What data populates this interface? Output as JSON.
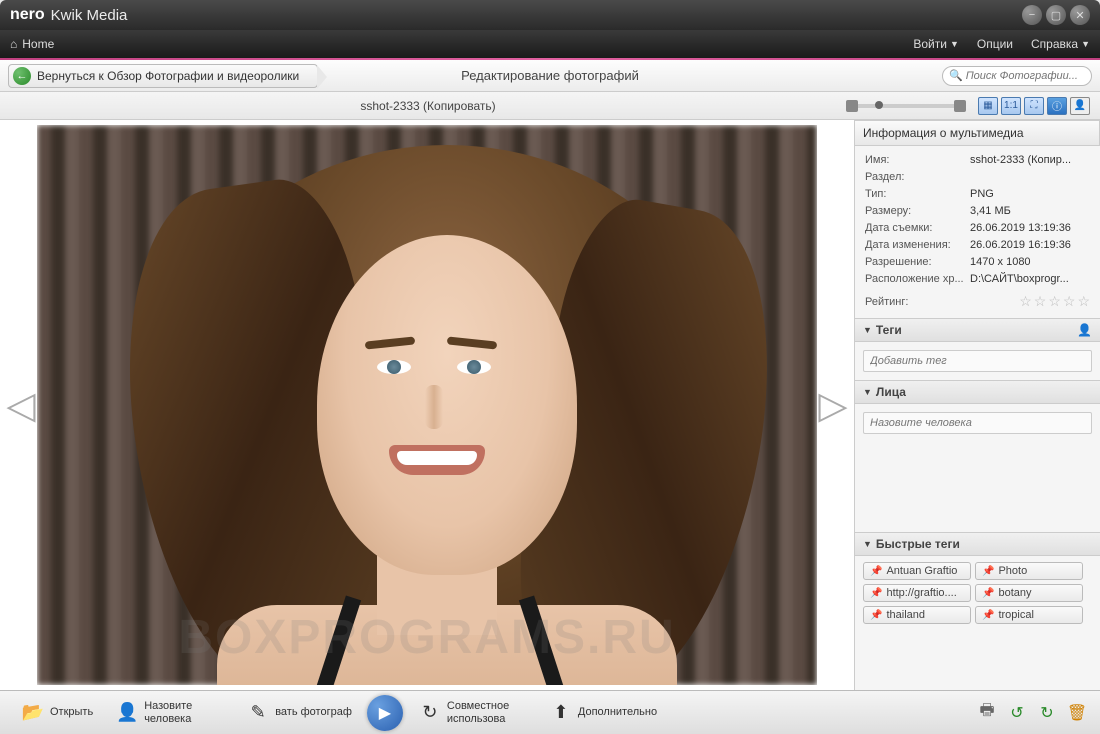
{
  "titlebar": {
    "brand": "nero",
    "product": "Kwik Media"
  },
  "menubar": {
    "home": "Home",
    "right": [
      {
        "label": "Войти",
        "chevron": true
      },
      {
        "label": "Опции",
        "chevron": false
      },
      {
        "label": "Справка",
        "chevron": true
      }
    ]
  },
  "breadcrumb": {
    "back": "Вернуться к Обзор Фотографии и видеоролики",
    "title": "Редактирование фотографий",
    "search_placeholder": "Поиск Фотографии..."
  },
  "file_row": {
    "name": "sshot-2333 (Копировать)"
  },
  "view_icons": [
    "fit-window-icon",
    "actual-size-icon",
    "fullscreen-icon",
    "info-icon",
    "user-icon"
  ],
  "watermark": "BOXPROGRAMS.RU",
  "info_panel": {
    "title": "Информация о мультимедиа",
    "rows": [
      {
        "k": "Имя:",
        "v": "sshot-2333 (Копир..."
      },
      {
        "k": "Раздел:",
        "v": ""
      },
      {
        "k": "Тип:",
        "v": "PNG"
      },
      {
        "k": "Размеру:",
        "v": "3,41 МБ"
      },
      {
        "k": "Дата съемки:",
        "v": "26.06.2019 13:19:36"
      },
      {
        "k": "Дата изменения:",
        "v": "26.06.2019 16:19:36"
      },
      {
        "k": "Разрешение:",
        "v": "1470 x 1080"
      },
      {
        "k": "Расположение хр...",
        "v": "D:\\САЙТ\\boxprogr..."
      }
    ],
    "rating_label": "Рейтинг:"
  },
  "sections": {
    "tags": {
      "title": "Теги",
      "placeholder": "Добавить тег"
    },
    "faces": {
      "title": "Лица",
      "placeholder": "Назовите человека"
    },
    "quick": {
      "title": "Быстрые теги",
      "items": [
        "Antuan Graftio",
        "Photo",
        "http://graftio....",
        "botany",
        "thailand",
        "tropical"
      ]
    }
  },
  "bottom": {
    "buttons": [
      {
        "icon": "📂",
        "label": "Открыть",
        "name": "open-button"
      },
      {
        "icon": "👤",
        "label": "Назовите человека",
        "name": "name-person-button"
      },
      {
        "icon": "✎",
        "label": "вать фотограф",
        "name": "edit-photo-button"
      }
    ],
    "buttons2": [
      {
        "icon": "↻",
        "label": "Совместное использова",
        "name": "share-button"
      },
      {
        "icon": "⬆",
        "label": "Дополнительно",
        "name": "more-button"
      }
    ],
    "right_icons": [
      "print-icon",
      "rotate-ccw-icon",
      "rotate-cw-icon",
      "delete-icon"
    ]
  }
}
